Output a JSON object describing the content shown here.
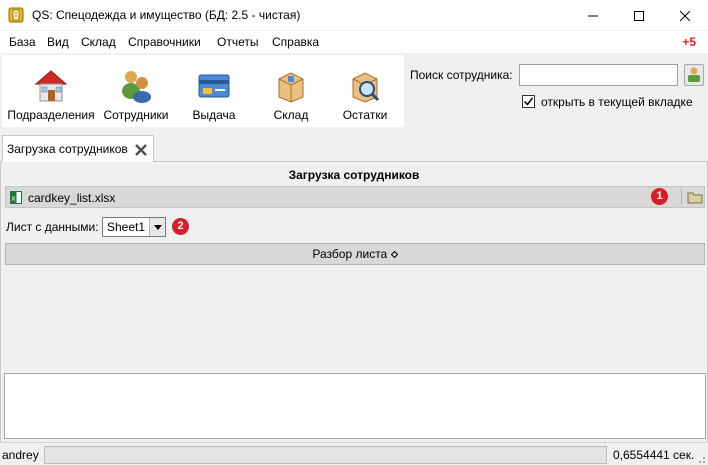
{
  "window": {
    "title": "QS: Спецодежда и имущество (БД: 2.5 - чистая)",
    "icons": {
      "app": "qs-app-icon",
      "minimize": "minimize-icon",
      "maximize": "maximize-icon",
      "close": "close-icon"
    }
  },
  "menu": {
    "items": [
      "База",
      "Вид",
      "Склад",
      "Справочники",
      "Отчеты",
      "Справка"
    ],
    "notification": "+5"
  },
  "toolbar": {
    "buttons": [
      {
        "label": "Подразделения",
        "icon": "house-icon"
      },
      {
        "label": "Сотрудники",
        "icon": "people-icon"
      },
      {
        "label": "Выдача",
        "icon": "card-icon"
      },
      {
        "label": "Склад",
        "icon": "box-icon"
      },
      {
        "label": "Остатки",
        "icon": "search-box-icon"
      }
    ]
  },
  "search": {
    "label": "Поиск сотрудника:",
    "value": "",
    "button_icon": "find-person-icon",
    "checkbox_label": "открыть в текущей вкладке",
    "checkbox_checked": true
  },
  "tabs": [
    {
      "label": "Загрузка сотрудников",
      "close_icon": "close-tab-icon"
    }
  ],
  "main": {
    "title": "Загрузка сотрудников",
    "file_name": "cardkey_list.xlsx",
    "file_icon": "excel-file-icon",
    "badge1": "1",
    "folder_icon": "folder-icon",
    "sheet_label": "Лист с данными:",
    "sheet_value": "Sheet1",
    "badge2": "2",
    "parse_label": "Разбор листа",
    "parse_icon": "expand-diamond-icon"
  },
  "status": {
    "user": "andrey",
    "time": "0,6554441 сек."
  },
  "colors": {
    "badge": "#d81e26",
    "notification": "#e02020",
    "panel_bg": "#f0f0f0",
    "bar_bg": "#d8d8d8"
  }
}
